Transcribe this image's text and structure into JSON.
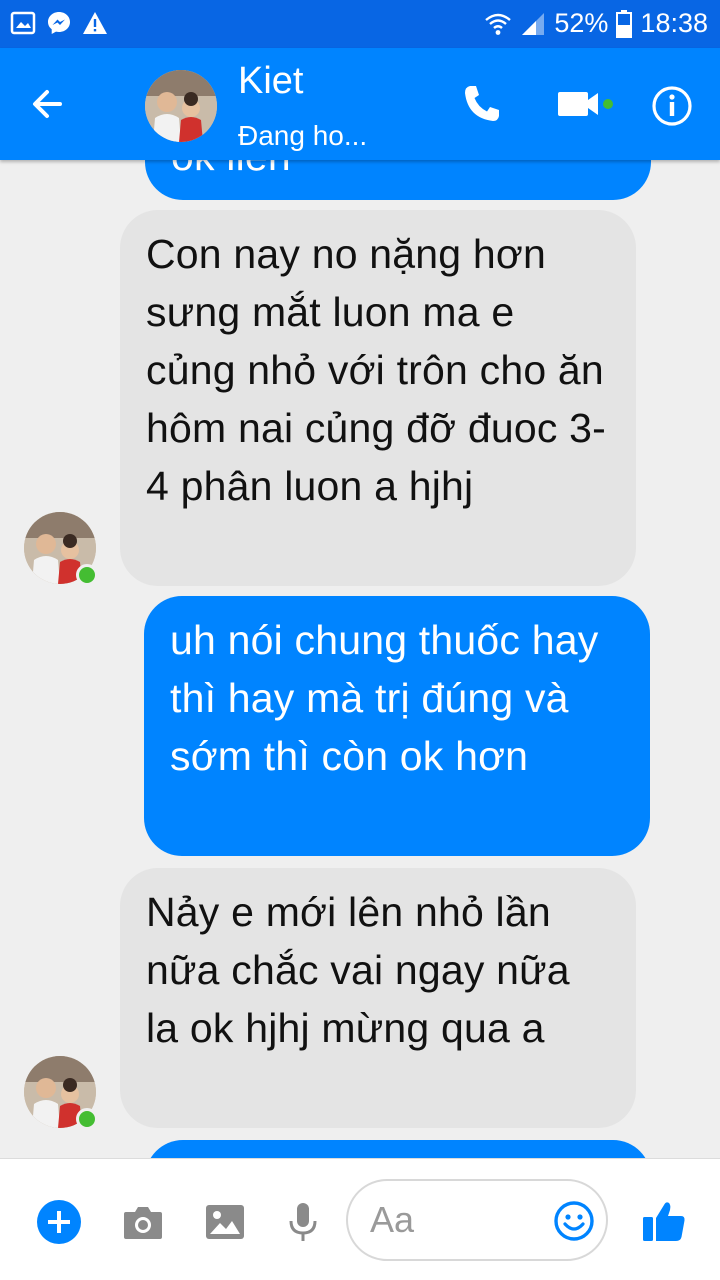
{
  "status_bar": {
    "battery": "52%",
    "time": "18:38",
    "icons": [
      "gallery-icon",
      "messenger-icon",
      "warning-icon",
      "wifi-icon",
      "signal-icon",
      "battery-icon"
    ]
  },
  "header": {
    "name": "Kiet",
    "status": "Đang ho...",
    "icons": [
      "back-arrow-icon",
      "phone-icon",
      "video-camera-icon",
      "info-icon"
    ]
  },
  "messages": [
    {
      "direction": "out",
      "text": "ok liền"
    },
    {
      "direction": "in",
      "text": "Con nay no nặng hơn sưng mắt luon ma e củng nhỏ với trôn cho ăn hôm nai củng đỡ đuoc 3-4 phân luon a hjhj"
    },
    {
      "direction": "out",
      "text": "uh nói chung thuốc hay thì hay mà trị đúng và sớm thì còn ok hơn"
    },
    {
      "direction": "in",
      "text": "Nảy e mới lên nhỏ lần nữa chắc vai ngay nữa la ok hjhj mừng qua a"
    },
    {
      "direction": "out",
      "text": ""
    }
  ],
  "composer": {
    "placeholder": "Aa",
    "icons": [
      "plus-icon",
      "camera-icon",
      "image-icon",
      "microphone-icon",
      "emoji-icon",
      "thumbs-up-icon"
    ]
  },
  "colors": {
    "messenger_blue": "#0084ff",
    "status_bar": "#0866e4",
    "incoming_bubble": "#e4e4e4",
    "background": "#efefef",
    "online": "#44bd32"
  }
}
